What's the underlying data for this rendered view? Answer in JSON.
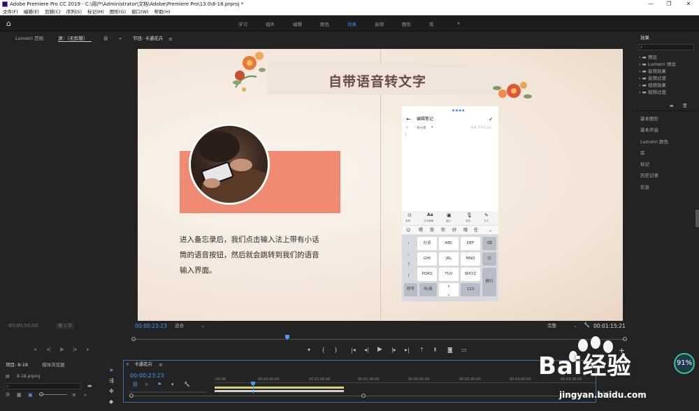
{
  "app": {
    "window_title": "Adobe Premiere Pro CC 2019 - C:\\用户\\Administrator\\文档\\Adobe\\Premiere Pro\\13.0\\8-18.prproj *"
  },
  "menu": [
    "文件(F)",
    "编辑(E)",
    "剪辑(C)",
    "序列(S)",
    "标记(M)",
    "图形(G)",
    "窗口(W)",
    "帮助(H)"
  ],
  "workspaces": {
    "tabs": [
      "学习",
      "组件",
      "编辑",
      "颜色",
      "效果",
      "音频",
      "图形",
      "库"
    ],
    "active": "效果",
    "overflow": "»"
  },
  "source_panel": {
    "tabs": [
      "Lumetri 范围",
      "源：（无剪辑）",
      "音"
    ],
    "more": "»",
    "timecode": "00;00;00;00",
    "page": "第 1 页"
  },
  "program_monitor": {
    "tab": "节目: 卡通花卉",
    "timecode": "00:00:23:23",
    "fit": "适合",
    "quality": "完整",
    "duration": "00:01:15:21"
  },
  "video": {
    "banner_title": "自带语音转文字",
    "body_lines": [
      "进入备忘录后，我们点击输入法上带有小话",
      "筒的语音按钮，然后就会跳转到我们的语音",
      "输入界面。"
    ],
    "phone": {
      "header": "编辑笔记",
      "category": "未分类",
      "date": "今天 下午1:44",
      "tools": [
        "清单",
        "Aa",
        "图片",
        "语音",
        "手写"
      ],
      "tool_labels": [
        "清单",
        "文本编辑",
        "图片",
        "语音",
        "手写"
      ],
      "candidates": [
        "😊",
        "嗯",
        "我",
        "你",
        "好",
        "哦",
        "在"
      ],
      "keys_row1": [
        "分词",
        "ABC",
        "DEF"
      ],
      "keys_row2": [
        "GHI",
        "JKL",
        "MNO"
      ],
      "keys_row3": [
        "PQRS",
        "TUV",
        "WXYZ"
      ],
      "left_keys": [
        "，",
        "。",
        "？",
        "！"
      ],
      "bottom_keys": [
        "符号",
        "中/英",
        "0",
        "123"
      ],
      "enter_key": "换行"
    }
  },
  "effects_panel": {
    "title": "效果",
    "search_placeholder": "",
    "tree": [
      "预设",
      "Lumetri 预设",
      "音频效果",
      "音频过渡",
      "视频效果",
      "视频过渡"
    ],
    "sections": [
      "基本图形",
      "基本声音",
      "Lumetri 颜色",
      "库",
      "标记",
      "历史记录",
      "信息"
    ]
  },
  "project_panel": {
    "tabs": [
      "项目: 8-18",
      "媒体浏览器"
    ],
    "file": "8-18.prproj"
  },
  "timeline": {
    "tab": "卡通花卉",
    "timecode": "00:00:23:23",
    "ruler": [
      ":00:00",
      "00:00:30:00",
      "00:01:00:00",
      "00:01:30:00",
      "00:02:00:00",
      "00:02:30:00",
      "00:03:00:00",
      "00:03:30:00"
    ],
    "playhead_fraction": 0.19
  },
  "watermark": {
    "text": "Bai经验",
    "url": "jingyan.baidu.com"
  },
  "cpu_badge": "91%",
  "colors": {
    "accent_blue": "#2d8ceb",
    "timecode_blue": "#4a9cf0",
    "salmon": "#f08b73",
    "track_yellow": "#d9d070"
  }
}
